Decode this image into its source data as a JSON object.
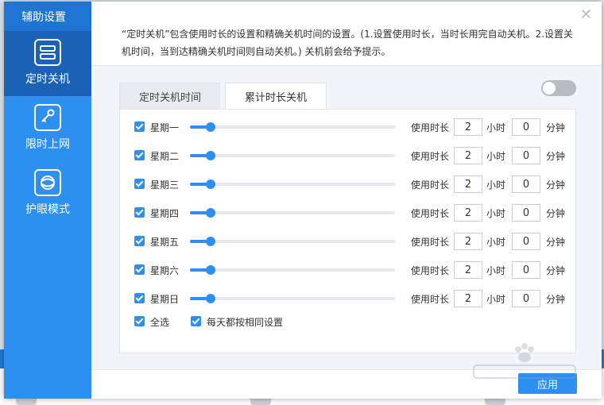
{
  "sidebar": {
    "title": "辅助设置",
    "items": [
      {
        "label": "定时关机",
        "icon": "schedule-list-icon",
        "active": true
      },
      {
        "label": "限时上网",
        "icon": "key-icon",
        "active": false
      },
      {
        "label": "护眼模式",
        "icon": "eye-care-icon",
        "active": false
      }
    ]
  },
  "description": "“定时关机”包含使用时长的设置和精确关机时间的设置。(1.设置使用时长，当时长用完自动关机。2.设置关机时间，当到达精确关机时间则自动关机。) 关机前会给予提示。",
  "tabs": [
    {
      "label": "定时关机时间",
      "active": false
    },
    {
      "label": "累计时长关机",
      "active": true
    }
  ],
  "toggle": {
    "on": false
  },
  "labels": {
    "use_duration": "使用时长",
    "hours_unit": "小时",
    "minutes_unit": "分钟"
  },
  "days": [
    {
      "name": "星期一",
      "checked": true,
      "hours": "2",
      "minutes": "0",
      "slider_fraction": 0.1
    },
    {
      "name": "星期二",
      "checked": true,
      "hours": "2",
      "minutes": "0",
      "slider_fraction": 0.1
    },
    {
      "name": "星期三",
      "checked": true,
      "hours": "2",
      "minutes": "0",
      "slider_fraction": 0.1
    },
    {
      "name": "星期四",
      "checked": true,
      "hours": "2",
      "minutes": "0",
      "slider_fraction": 0.1
    },
    {
      "name": "星期五",
      "checked": true,
      "hours": "2",
      "minutes": "0",
      "slider_fraction": 0.1
    },
    {
      "name": "星期六",
      "checked": true,
      "hours": "2",
      "minutes": "0",
      "slider_fraction": 0.1
    },
    {
      "name": "星期日",
      "checked": true,
      "hours": "2",
      "minutes": "0",
      "slider_fraction": 0.1
    }
  ],
  "options": {
    "select_all": "全选",
    "same_every_day": "每天都按相同设置"
  },
  "apply_label": "应用",
  "colors": {
    "accent": "#2d8ff0",
    "sidebar_active": "#1b62b6",
    "sidebar_header": "#1f75d4"
  }
}
